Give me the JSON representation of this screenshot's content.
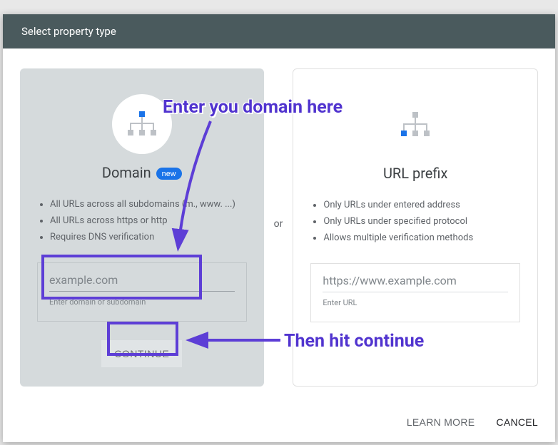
{
  "header": {
    "title": "Select property type"
  },
  "or_label": "or",
  "domain_card": {
    "title": "Domain",
    "badge": "new",
    "features": [
      "All URLs across all subdomains (m., www. ...)",
      "All URLs across https or http",
      "Requires DNS verification"
    ],
    "input": {
      "value": "example.com",
      "hint": "Enter domain or subdomain"
    },
    "continue": "CONTINUE"
  },
  "url_card": {
    "title": "URL prefix",
    "features": [
      "Only URLs under entered address",
      "Only URLs under specified protocol",
      "Allows multiple verification methods"
    ],
    "input": {
      "value": "https://www.example.com",
      "hint": "Enter URL"
    }
  },
  "footer": {
    "learn": "LEARN MORE",
    "cancel": "CANCEL"
  },
  "annotations": {
    "t1": "Enter you domain here",
    "t2": "Then hit continue"
  }
}
